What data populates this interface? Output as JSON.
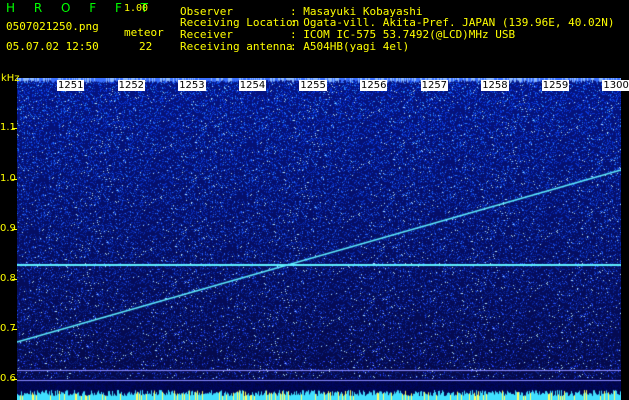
{
  "header": {
    "app_name": "H R O F F T",
    "version": "1.00",
    "filename": "0507021250.png",
    "datetime": "05.07.02 12:50",
    "meteor_label": "meteor",
    "meteor_count": "22",
    "info": [
      {
        "label": "Observer",
        "value": ": Masayuki Kobayashi"
      },
      {
        "label": "Receiving Location",
        "value": ": Ogata-vill. Akita-Pref. JAPAN (139.96E, 40.02N)"
      },
      {
        "label": "Receiver",
        "value": ": ICOM IC-575 53.7492(@LCD)MHz USB"
      },
      {
        "label": "Receiving antenna",
        "value": ": A504HB(yagi 4el)"
      }
    ]
  },
  "spectrogram": {
    "y_unit": "kHz",
    "y_ticks": [
      "1.1",
      "1.0",
      "0.9",
      "0.8",
      "0.7",
      "0.6"
    ],
    "time_ticks": [
      "1251",
      "1252",
      "1253",
      "1254",
      "1255",
      "1256",
      "1257",
      "1258",
      "1259",
      "1300"
    ],
    "colors": {
      "background": "#000000",
      "text": "#ffff00",
      "title": "#00ff00",
      "noise_base": "#0a1a8a",
      "signal": "#5ff0ff"
    }
  }
}
